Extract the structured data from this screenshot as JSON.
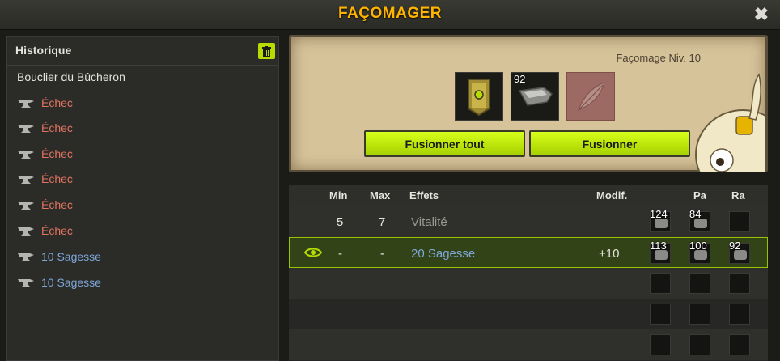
{
  "window": {
    "title": "FAÇOMAGER",
    "close_label": "✖"
  },
  "history": {
    "title": "Historique",
    "trash_icon": "trash-icon",
    "item_name": "Bouclier du Bûcheron",
    "entries": [
      {
        "label": "Échec",
        "status": "fail"
      },
      {
        "label": "Échec",
        "status": "fail"
      },
      {
        "label": "Échec",
        "status": "fail"
      },
      {
        "label": "Échec",
        "status": "fail"
      },
      {
        "label": "Échec",
        "status": "fail"
      },
      {
        "label": "Échec",
        "status": "fail"
      },
      {
        "label": "10 Sagesse",
        "status": "success"
      },
      {
        "label": "10 Sagesse",
        "status": "success"
      }
    ]
  },
  "forge": {
    "level_label": "Façomage Niv. 10",
    "rune_count": "92",
    "fuse_all_label": "Fusionner tout",
    "fuse_label": "Fusionner"
  },
  "table": {
    "headers": {
      "min": "Min",
      "max": "Max",
      "effects": "Effets",
      "modif": "Modif.",
      "pa": "Pa",
      "ra": "Ra"
    },
    "rows": [
      {
        "min": "5",
        "max": "7",
        "effect": "Vitalité",
        "modif": "",
        "ba_count": "124",
        "pa_count": "84",
        "ra_count": ""
      },
      {
        "min": "-",
        "max": "-",
        "effect": "20 Sagesse",
        "modif": "+10",
        "ba_count": "113",
        "pa_count": "100",
        "ra_count": "92"
      }
    ]
  },
  "colors": {
    "accent": "#b8dc00",
    "title": "#ffb400",
    "fail": "#e07360",
    "success": "#7ea7d8"
  }
}
